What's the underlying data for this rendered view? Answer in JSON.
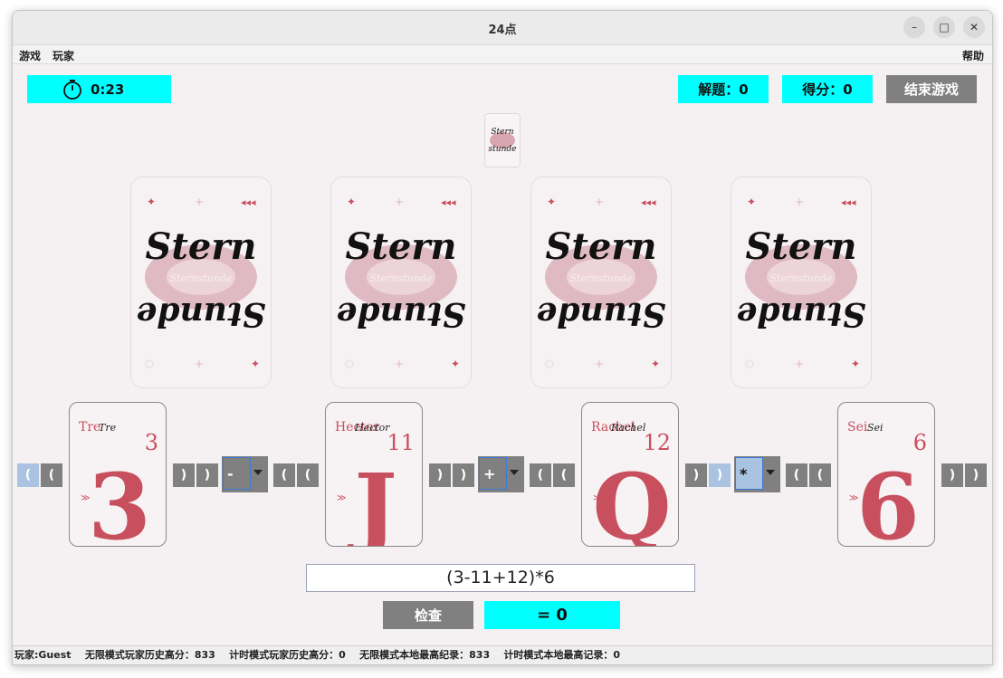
{
  "window": {
    "title": "24点"
  },
  "window_controls": {
    "minimize": "–",
    "maximize": "□",
    "close": "✕"
  },
  "menu": {
    "game": "游戏",
    "player": "玩家",
    "help": "帮助"
  },
  "timer": {
    "value": "0:23",
    "icon": "stopwatch-icon"
  },
  "stats": {
    "solved": "解题：0",
    "score": "得分：0"
  },
  "end_button": "结束游戏",
  "cards": [
    {
      "rank": "3",
      "name": "Tre",
      "script": "Tre",
      "letter": "3"
    },
    {
      "rank": "11",
      "name": "Hector",
      "script": "Hector",
      "letter": "J"
    },
    {
      "rank": "12",
      "name": "Rachel",
      "script": "Rachel",
      "letter": "Q"
    },
    {
      "rank": "6",
      "name": "Sei",
      "script": "Sei",
      "letter": "6"
    }
  ],
  "card_back": {
    "text_top": "Stern",
    "text_middle": "Sternstunde",
    "text_bottom": "Stunde"
  },
  "parens": {
    "open": "(",
    "close": ")"
  },
  "operators": [
    "-",
    "+",
    "*"
  ],
  "expression": "(3-11+12)*6",
  "check_button": "检查",
  "result": "= 0",
  "status": {
    "player": "玩家:Guest",
    "unlimited_player_best": "无限模式玩家历史高分：833",
    "timed_player_best": "计时模式玩家历史高分：0",
    "unlimited_local_best": "无限模式本地最高纪录：833",
    "timed_local_best": "计时模式本地最高记录：0"
  },
  "colors": {
    "accent": "#00ffff",
    "button_gray": "#808080",
    "card_red": "#c8505e",
    "selected_blue": "#a9c3e0"
  }
}
